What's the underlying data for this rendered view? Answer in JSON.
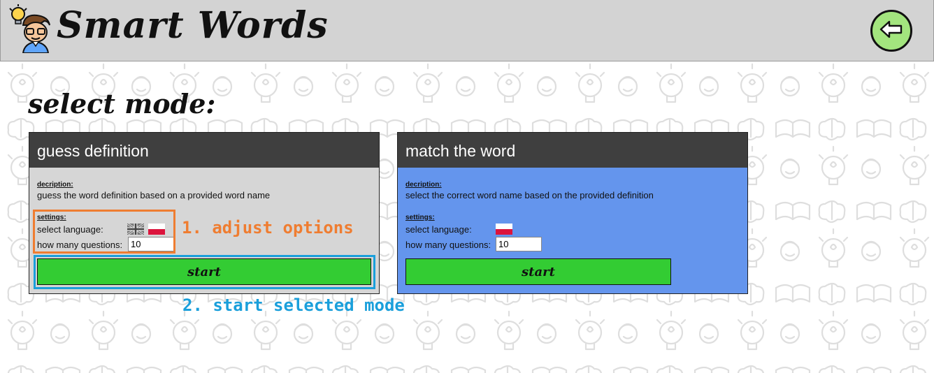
{
  "header": {
    "title": "Smart Words",
    "back_icon": "arrow-left-icon",
    "logo_icon": "student-lightbulb-icon"
  },
  "main": {
    "title": "select mode:"
  },
  "modes": [
    {
      "title": "guess definition",
      "description_label": "decription:",
      "description": "guess the word definition based on a provided word name",
      "settings_label": "settings:",
      "language_label": "select language:",
      "languages": [
        "english-flag-icon",
        "polish-flag-icon"
      ],
      "questions_label": "how many questions:",
      "questions_value": "10",
      "start_label": "start"
    },
    {
      "title": "match the word",
      "description_label": "decription:",
      "description": "select the correct word name based on the provided definition",
      "settings_label": "settings:",
      "language_label": "select language:",
      "languages": [
        "polish-flag-icon"
      ],
      "questions_label": "how many questions:",
      "questions_value": "10",
      "start_label": "start"
    }
  ],
  "annotations": [
    {
      "text": "1. adjust options",
      "color": "#ef7d31"
    },
    {
      "text": "2. start selected mode",
      "color": "#1a9fdb"
    }
  ],
  "colors": {
    "header_bg": "#d3d3d3",
    "card_header": "#3f3f3f",
    "guess_bg": "#d6d6d6",
    "match_bg": "#6495ed",
    "start_button": "#33cc33",
    "back_button": "#a3e57e"
  }
}
